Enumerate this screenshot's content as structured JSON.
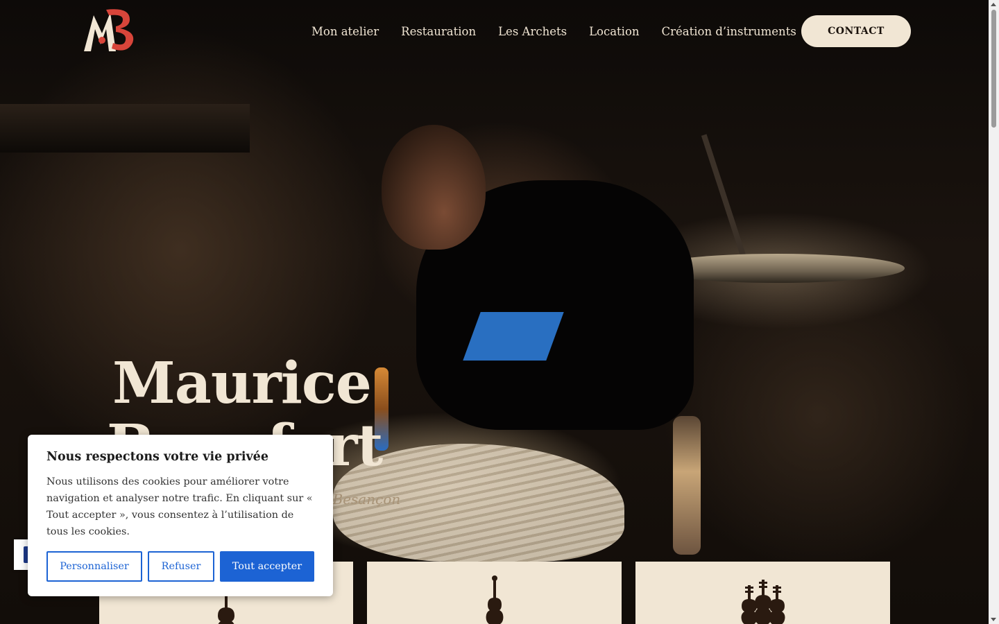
{
  "brand": {
    "logo_icon": "mb-monogram-logo",
    "colors": {
      "cream": "#f1e6d4",
      "accent_blue": "#1c63d4",
      "logo_red": "#d8453a"
    }
  },
  "nav": {
    "items": [
      {
        "label": "Mon atelier"
      },
      {
        "label": "Restauration"
      },
      {
        "label": "Les Archets"
      },
      {
        "label": "Location"
      },
      {
        "label": "Création d’instruments"
      }
    ],
    "contact_label": "CONTACT"
  },
  "hero": {
    "title_line1": "Maurice",
    "title_line2": "Beaufort",
    "subtitle": "Luthier à Besançon"
  },
  "cards": [
    {
      "icon": "violin-icon"
    },
    {
      "icon": "double-bass-icon"
    },
    {
      "icon": "violins-trio-icon"
    }
  ],
  "cookie_banner": {
    "title": "Nous respectons votre vie privée",
    "text": "Nous utilisons des cookies pour améliorer votre navigation et analyser notre trafic. En cliquant sur « Tout accepter », vous consentez à l’utilisation de tous les cookies.",
    "customize_label": "Personnaliser",
    "refuse_label": "Refuser",
    "accept_label": "Tout accepter"
  },
  "accessibility": {
    "icon": "accessibility-icon"
  }
}
